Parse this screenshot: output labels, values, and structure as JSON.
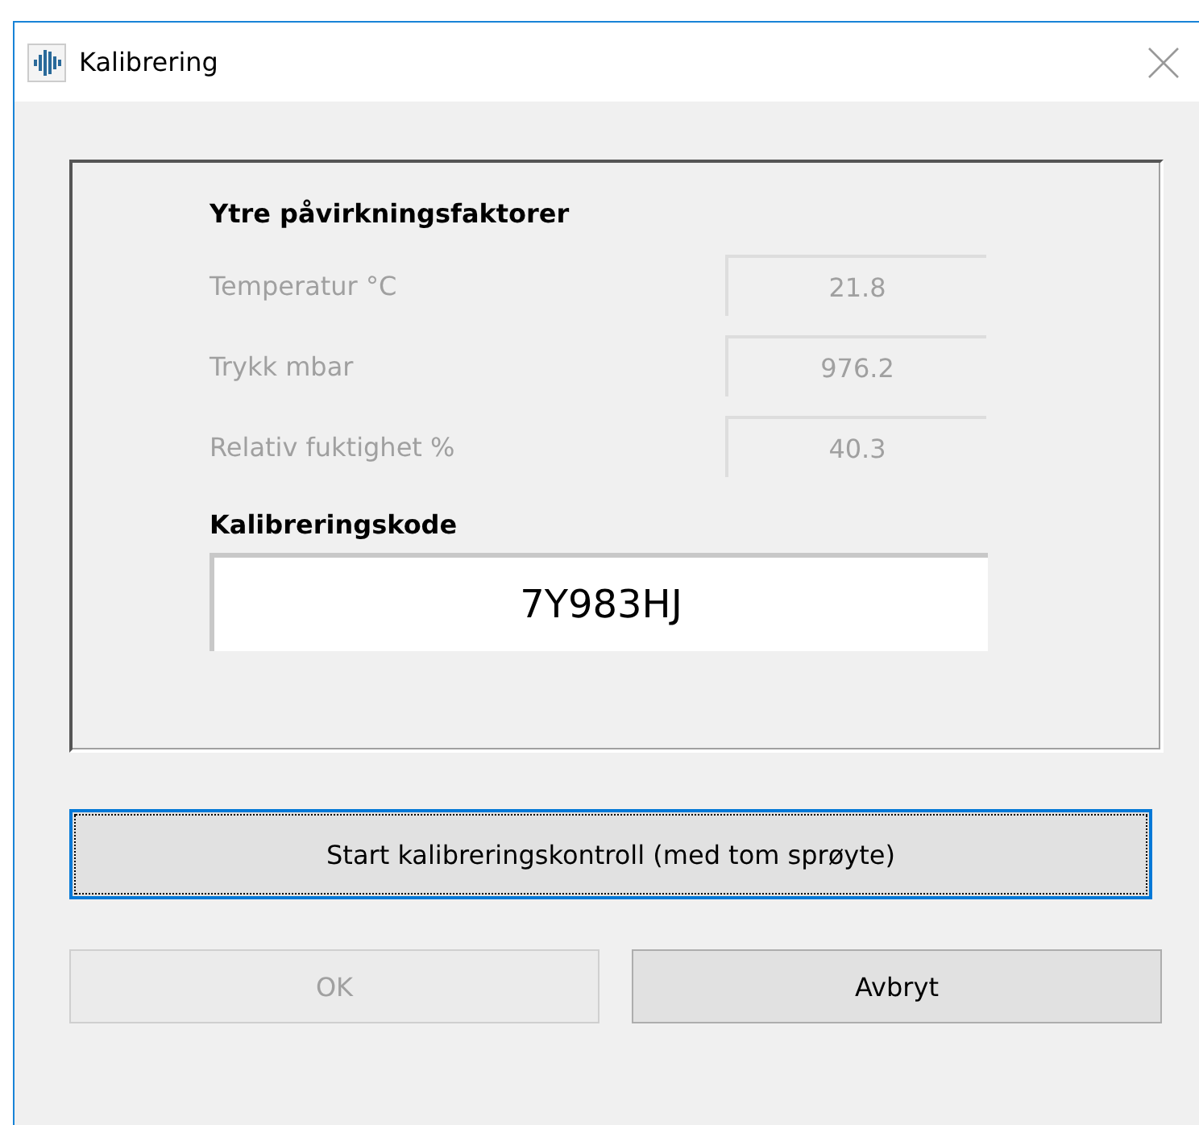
{
  "window": {
    "title": "Kalibrering"
  },
  "factors": {
    "heading": "Ytre påvirkningsfaktorer",
    "rows": [
      {
        "label": "Temperatur °C",
        "value": "21.8",
        "disabled": true
      },
      {
        "label": "Trykk mbar",
        "value": "976.2",
        "disabled": true
      },
      {
        "label": "Relativ fuktighet %",
        "value": "40.3",
        "disabled": true
      }
    ]
  },
  "code": {
    "heading": "Kalibreringskode",
    "value": "7Y983HJ"
  },
  "start_button": {
    "label": "Start kalibreringskontroll (med tom sprøyte)",
    "focused": true
  },
  "buttons": [
    {
      "label": "OK",
      "disabled": true
    },
    {
      "label": "Avbryt",
      "disabled": false
    }
  ]
}
